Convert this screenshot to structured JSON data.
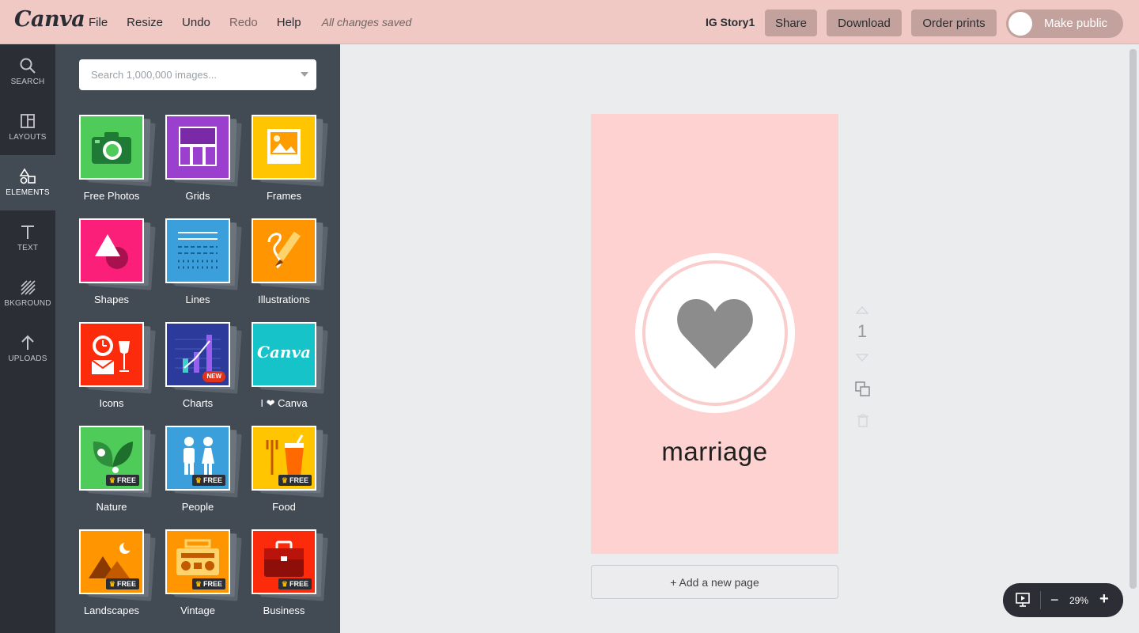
{
  "app": {
    "logo": "Canva",
    "menu": [
      "File",
      "Resize",
      "Undo",
      "Redo",
      "Help"
    ],
    "saved_status": "All changes saved",
    "design_title": "IG Story1",
    "share_label": "Share",
    "download_label": "Download",
    "prints_label": "Order prints",
    "public_label": "Make public",
    "brand_color": "#f1c9c4"
  },
  "sidebar": {
    "items": [
      {
        "label": "SEARCH",
        "icon": "search-icon"
      },
      {
        "label": "LAYOUTS",
        "icon": "layouts-icon"
      },
      {
        "label": "ELEMENTS",
        "icon": "elements-icon",
        "active": true
      },
      {
        "label": "TEXT",
        "icon": "text-icon"
      },
      {
        "label": "BKGROUND",
        "icon": "background-icon"
      },
      {
        "label": "UPLOADS",
        "icon": "upload-icon"
      }
    ]
  },
  "panel": {
    "search_placeholder": "Search 1,000,000 images...",
    "tiles": [
      {
        "label": "Free Photos",
        "color": "#4fcb5a"
      },
      {
        "label": "Grids",
        "color": "#9b3fcf"
      },
      {
        "label": "Frames",
        "color": "#ffc501"
      },
      {
        "label": "Shapes",
        "color": "#fb1f7a"
      },
      {
        "label": "Lines",
        "color": "#3b9fdc"
      },
      {
        "label": "Illustrations",
        "color": "#ff9500"
      },
      {
        "label": "Icons",
        "color": "#fb2b0b"
      },
      {
        "label": "Charts",
        "color": "#2c3a9c",
        "badge": "NEW"
      },
      {
        "label": "I ❤ Canva",
        "color": "#16c3c9"
      },
      {
        "label": "Nature",
        "color": "#4fcb5a",
        "badge": "FREE"
      },
      {
        "label": "People",
        "color": "#3b9fdc",
        "badge": "FREE"
      },
      {
        "label": "Food",
        "color": "#ffc501",
        "badge": "FREE"
      },
      {
        "label": "Landscapes",
        "color": "#ff9500",
        "badge": "FREE"
      },
      {
        "label": "Vintage",
        "color": "#ff9500",
        "badge": "FREE"
      },
      {
        "label": "Business",
        "color": "#fb2b0b",
        "badge": "FREE"
      }
    ]
  },
  "canvas": {
    "page_text": "marriage",
    "page_color": "#fed2d0",
    "page_number": "1",
    "add_page_label": "+ Add a new page"
  },
  "zoom": {
    "value": "29%",
    "minus": "−",
    "plus": "+"
  }
}
